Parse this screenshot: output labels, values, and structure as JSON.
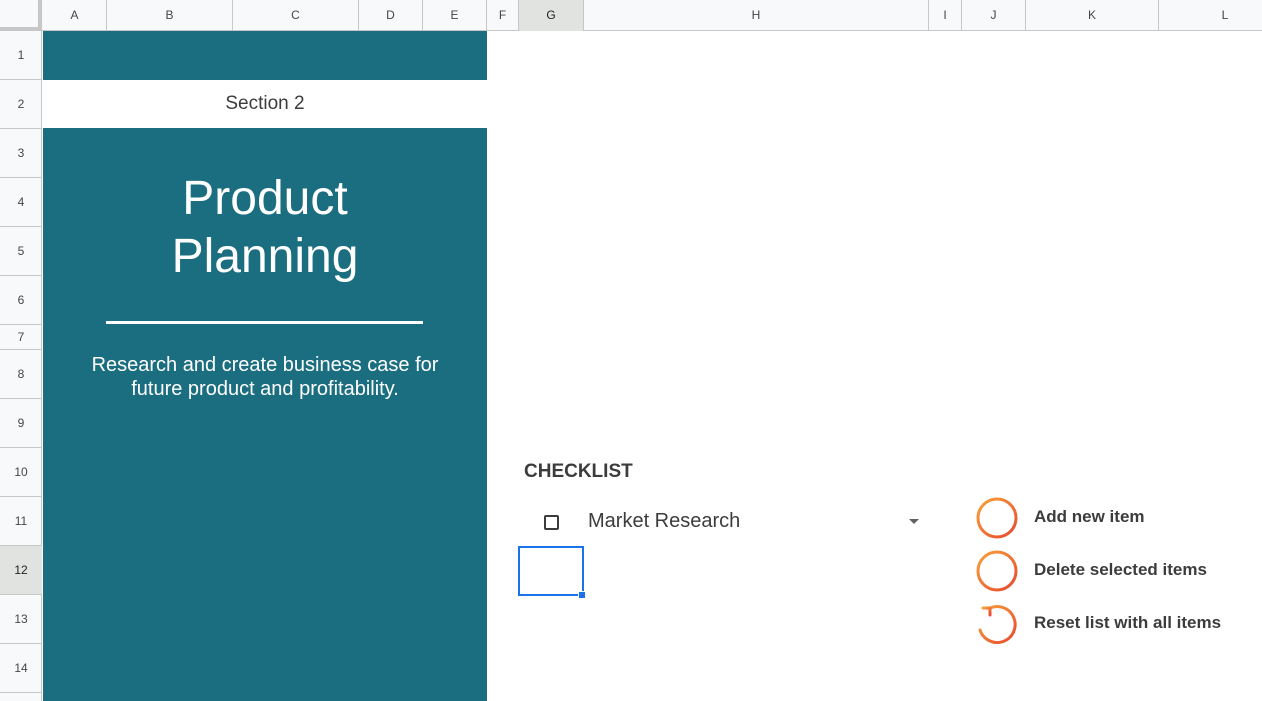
{
  "columns": [
    {
      "label": "A"
    },
    {
      "label": "B"
    },
    {
      "label": "C"
    },
    {
      "label": "D"
    },
    {
      "label": "E"
    },
    {
      "label": "F"
    },
    {
      "label": "G"
    },
    {
      "label": "H"
    },
    {
      "label": "I"
    },
    {
      "label": "J"
    },
    {
      "label": "K"
    },
    {
      "label": "L"
    }
  ],
  "rows": [
    "1",
    "2",
    "3",
    "4",
    "5",
    "6",
    "7",
    "8",
    "9",
    "10",
    "11",
    "12",
    "13",
    "14"
  ],
  "selected_cell": {
    "column": "G",
    "row": "12"
  },
  "panel": {
    "section": "Section 2",
    "title_line1": "Product",
    "title_line2": "Planning",
    "description": "Research and create business case for future product and profitability.",
    "color": "#1b6e80"
  },
  "checklist": {
    "title": "CHECKLIST",
    "items": [
      {
        "label": "Market Research",
        "checked": false
      }
    ]
  },
  "actions": {
    "add_label": "Add new item",
    "delete_label": "Delete selected items",
    "reset_label": "Reset list with all items",
    "icon_color": "#f2892b"
  }
}
